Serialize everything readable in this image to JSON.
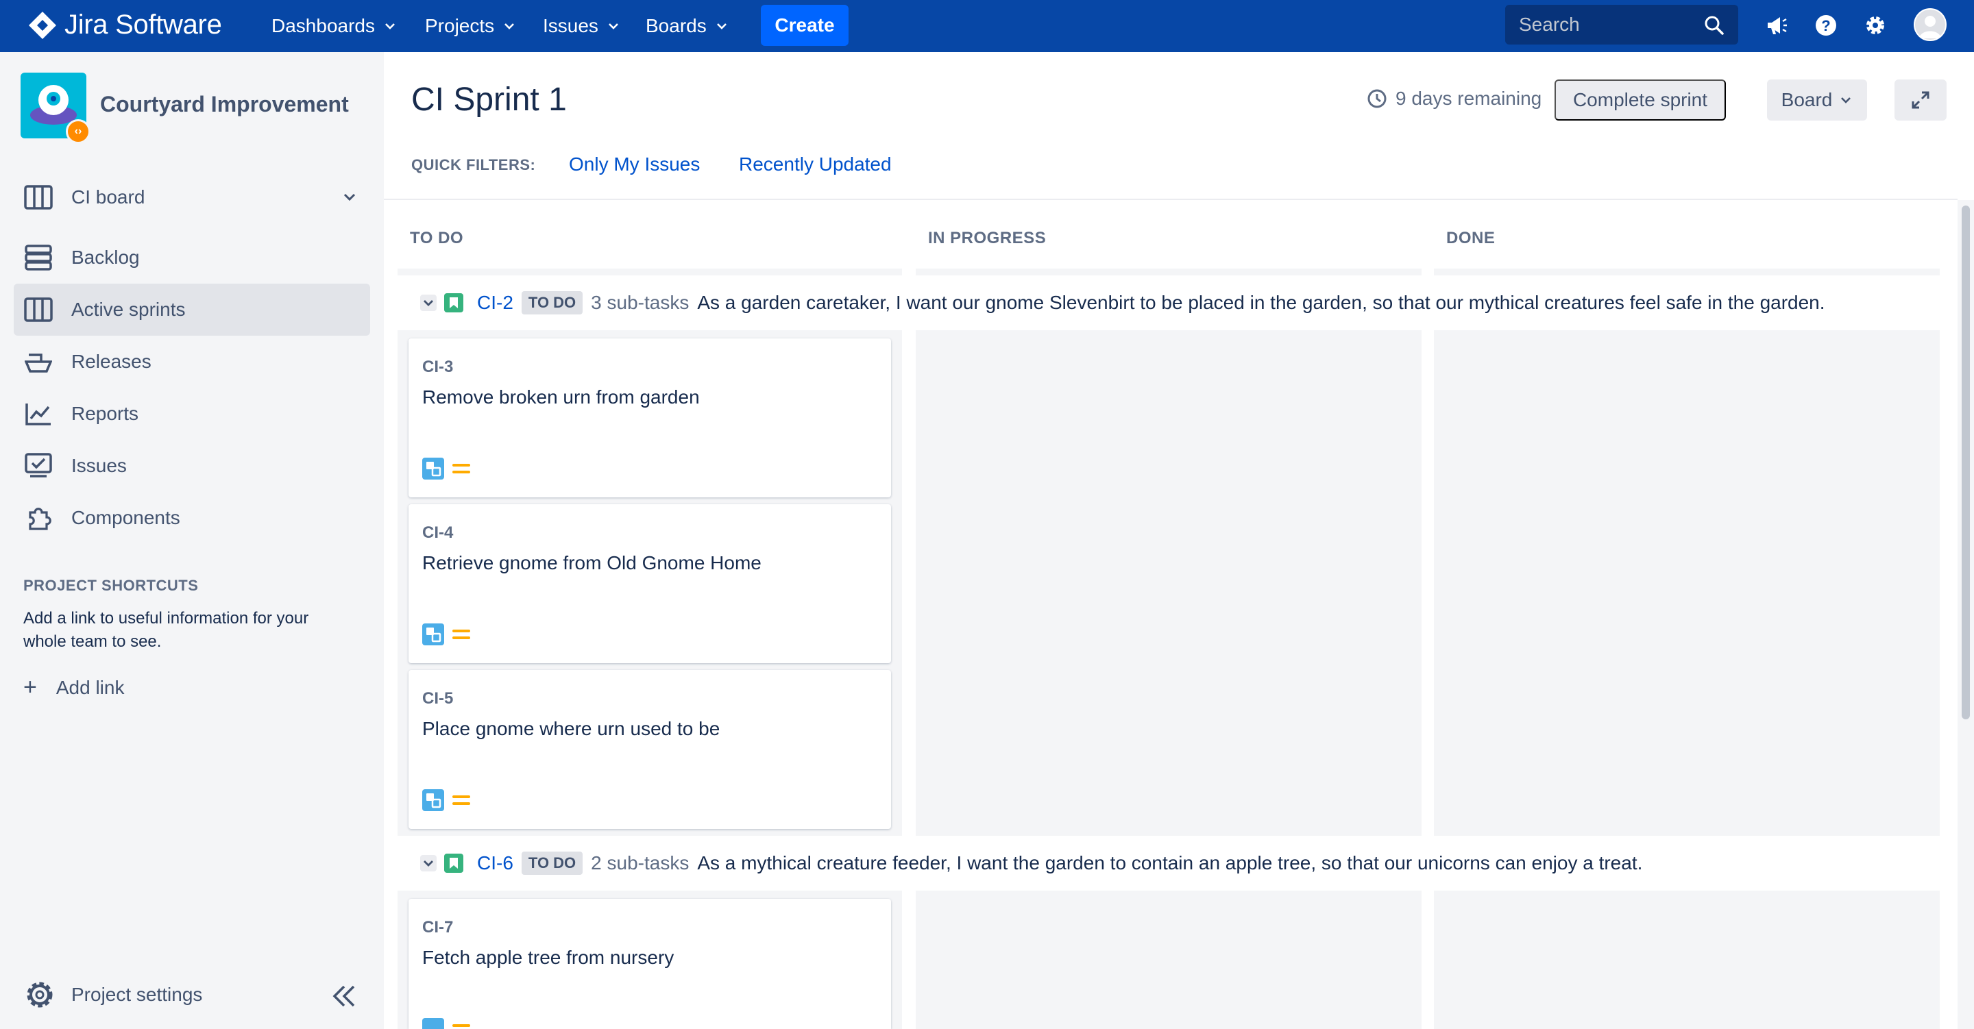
{
  "topnav": {
    "brand": "Jira Software",
    "menu": [
      {
        "label": "Dashboards"
      },
      {
        "label": "Projects"
      },
      {
        "label": "Issues"
      },
      {
        "label": "Boards"
      }
    ],
    "create_label": "Create",
    "search_placeholder": "Search",
    "icons": [
      "megaphone-icon",
      "help-icon",
      "settings-icon",
      "user-avatar"
    ]
  },
  "sidebar": {
    "project_name": "Courtyard Improvement",
    "board_label": "CI board",
    "items": [
      {
        "label": "Backlog",
        "icon": "backlog-icon"
      },
      {
        "label": "Active sprints",
        "icon": "board-icon",
        "active": true
      },
      {
        "label": "Releases",
        "icon": "ship-icon"
      },
      {
        "label": "Reports",
        "icon": "chart-icon"
      },
      {
        "label": "Issues",
        "icon": "issues-icon"
      },
      {
        "label": "Components",
        "icon": "puzzle-icon"
      }
    ],
    "shortcuts_heading": "PROJECT SHORTCUTS",
    "shortcuts_desc": "Add a link to useful information for your whole team to see.",
    "add_link": "Add link",
    "settings_label": "Project settings"
  },
  "header": {
    "title": "CI Sprint 1",
    "days_remaining": "9 days remaining",
    "complete_sprint": "Complete sprint",
    "board_menu": "Board",
    "quick_filters_label": "QUICK FILTERS:",
    "quick_filters": [
      "Only My Issues",
      "Recently Updated"
    ]
  },
  "board": {
    "columns": [
      "TO DO",
      "IN PROGRESS",
      "DONE"
    ],
    "swimlanes": [
      {
        "key": "CI-2",
        "status": "TO DO",
        "subtasks": "3 sub-tasks",
        "summary": "As a garden caretaker, I want our gnome Slevenbirt to be placed in the garden, so that our mythical creatures feel safe in the garden.",
        "cards": [
          {
            "key": "CI-3",
            "title": "Remove broken urn from garden"
          },
          {
            "key": "CI-4",
            "title": "Retrieve gnome from Old Gnome Home"
          },
          {
            "key": "CI-5",
            "title": "Place gnome where urn used to be"
          }
        ]
      },
      {
        "key": "CI-6",
        "status": "TO DO",
        "subtasks": "2 sub-tasks",
        "summary": "As a mythical creature feeder, I want the garden to contain an apple tree, so that our unicorns can enjoy a treat.",
        "cards": [
          {
            "key": "CI-7",
            "title": "Fetch apple tree from nursery"
          }
        ]
      }
    ]
  },
  "colors": {
    "nav_bg": "#0747a6",
    "create_bg": "#0065ff",
    "link": "#0052cc",
    "story_green": "#36b37e",
    "priority_orange": "#ffab00",
    "subtask_blue": "#4bade8"
  }
}
